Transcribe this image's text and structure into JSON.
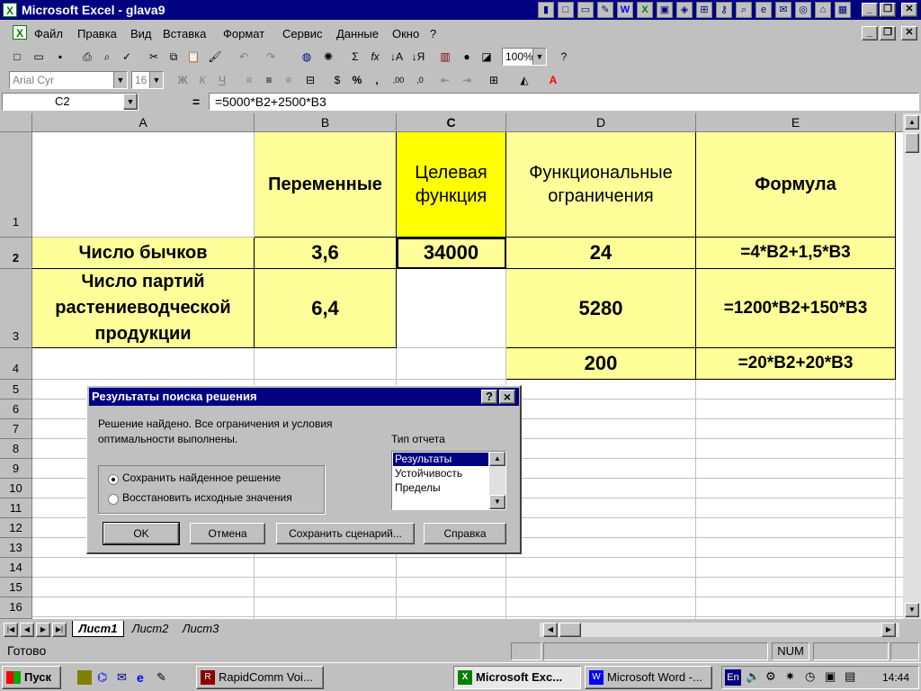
{
  "window": {
    "title": "Microsoft Excel - glava9"
  },
  "menu": [
    "Файл",
    "Правка",
    "Вид",
    "Вставка",
    "Формат",
    "Сервис",
    "Данные",
    "Окно",
    "?"
  ],
  "toolbar": {
    "zoom": "100%",
    "font": "Arial Cyr",
    "size": "16"
  },
  "formula_bar": {
    "name_box": "C2",
    "equals": "=",
    "formula": "=5000*B2+2500*B3"
  },
  "columns": [
    "A",
    "B",
    "C",
    "D",
    "E"
  ],
  "rows": [
    "1",
    "2",
    "3",
    "4",
    "5",
    "6",
    "7",
    "8",
    "9",
    "10",
    "11",
    "12",
    "13",
    "14",
    "15",
    "16"
  ],
  "cells": {
    "B1": "Переменные",
    "C1": "Целевая функция",
    "D1": "Функциональные ограничения",
    "E1": "Формула",
    "A2": "Число бычков",
    "B2": "3,6",
    "C2": "34000",
    "D2": "24",
    "E2": "=4*B2+1,5*B3",
    "A3": "Число партий растениеводческой продукции",
    "B3": "6,4",
    "D3": "5280",
    "E3": "=1200*B2+150*B3",
    "D4": "200",
    "E4": "=20*B2+20*B3"
  },
  "dialog": {
    "title": "Результаты поиска решения",
    "message": "Решение найдено. Все ограничения и условия оптимальности выполнены.",
    "report_label": "Тип отчета",
    "reports": [
      "Результаты",
      "Устойчивость",
      "Пределы"
    ],
    "option_keep": "Сохранить найденное решение",
    "option_restore": "Восстановить исходные значения",
    "btn_ok": "OK",
    "btn_cancel": "Отмена",
    "btn_scenario": "Сохранить сценарий...",
    "btn_help": "Справка",
    "help_glyph": "?",
    "close_glyph": "×"
  },
  "sheets": [
    "Лист1",
    "Лист2",
    "Лист3"
  ],
  "status": {
    "ready": "Готово",
    "num": "NUM"
  },
  "taskbar": {
    "start": "Пуск",
    "tasks": [
      "RapidComm Voi...",
      "Microsoft Exc...",
      "Microsoft Word -..."
    ],
    "lang": "En",
    "clock": "14:44"
  }
}
